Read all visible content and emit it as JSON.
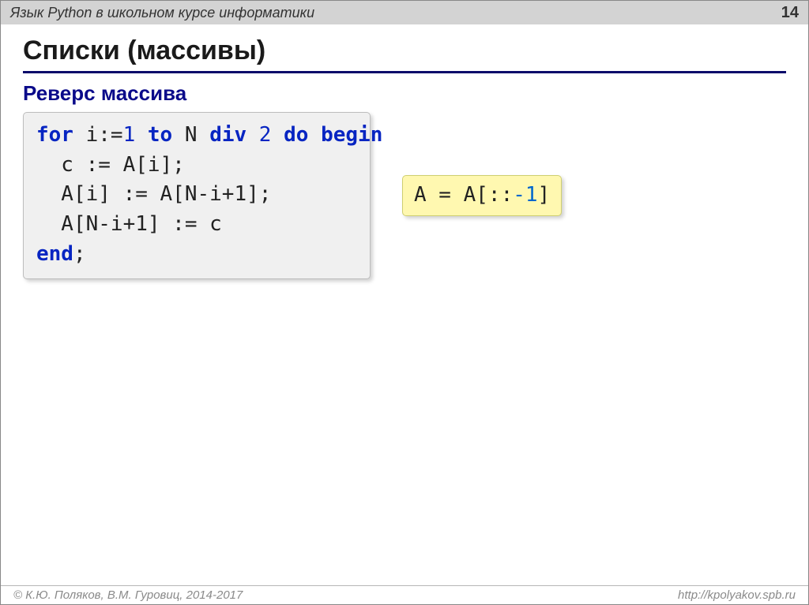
{
  "topbar": {
    "title": "Язык Python в школьном курсе информатики",
    "page": "14"
  },
  "title": "Списки (массивы)",
  "subtitle": "Реверс массива",
  "pascal": {
    "kw_for": "for",
    "i_eq": " i:=",
    "one": "1",
    "kw_to": " to",
    "n_div": " N ",
    "kw_div": "div",
    "two": " 2",
    "kw_do": " do",
    "kw_begin": " begin",
    "l2": "  c := A[i];",
    "l3": "  A[i] := A[N-i+1];",
    "l4": "  A[N-i+1] := c",
    "kw_end": "end",
    "semi": ";"
  },
  "python": {
    "lhs": "A = A[::",
    "neg1": "-1",
    "rhs": "]"
  },
  "footer": {
    "left": "© К.Ю. Поляков, В.М. Гуровиц, 2014-2017",
    "right": "http://kpolyakov.spb.ru"
  }
}
